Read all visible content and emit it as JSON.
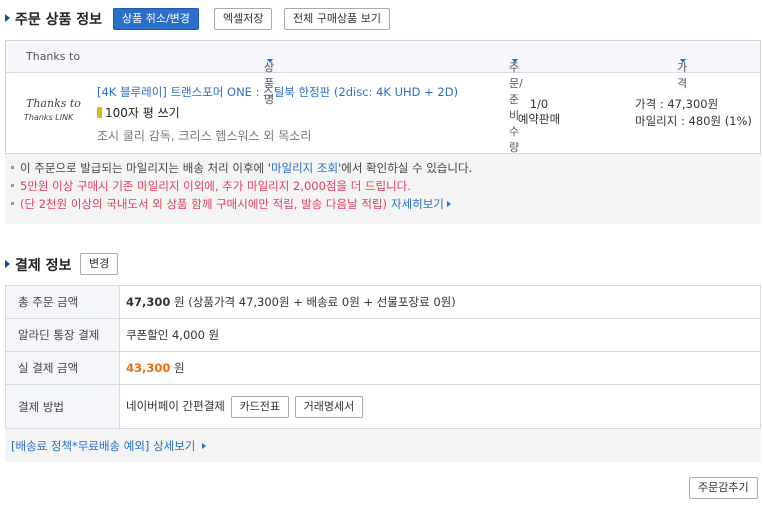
{
  "order_section": {
    "title": "주문 상품 정보",
    "buttons": {
      "cancel_change": "상품 취소/변경",
      "excel": "엑셀저장",
      "view_all": "전체 구매상품 보기"
    },
    "headers": {
      "thanks_to": "Thanks to",
      "product_name": "상품명",
      "order_qty": "주문/준비수량",
      "price": "가격"
    },
    "item": {
      "logo_line1": "Thanks to",
      "logo_line2": "Thanks LINK",
      "title": "[4K 블루레이] 트랜스포머 ONE : 스틸북 한정판 (2disc: 4K UHD + 2D)",
      "review": "100자 평 쓰기",
      "credits": "조시 쿨리 감독, 크리스 헴스워스 외 목소리",
      "qty": "1/0",
      "sale_type": "예약판매",
      "price": "가격 : 47,300원",
      "mileage": "마일리지 : 480원 (1%)"
    },
    "notices": {
      "n1_a": "이 주문으로 발급되는 마일리지는 배송 처리 이후에 '",
      "n1_link": "마일리지 조회",
      "n1_b": "'에서 확인하실 수 있습니다.",
      "n2": "5만원 이상 구매시 기존 마일리지 이외에, 추가 마일리지 2,000점을 더 드립니다.",
      "n3": "(단 2천원 이상의 국내도서 외 상품 함께 구매시에만 적립, 발송 다음날 적립)",
      "more": "자세히보기"
    }
  },
  "payment_section": {
    "title": "결제 정보",
    "change_button": "변경",
    "rows": {
      "total_label": "총 주문 금액",
      "total_amount": "47,300",
      "total_unit": "원",
      "total_detail": "(상품가격 47,300원 + 배송료 0원 + 선물포장료 0원)",
      "account_label": "알라딘 통장 결제",
      "account_value": "쿠폰할인 4,000 원",
      "actual_label": "실 결제 금액",
      "actual_amount": "43,300",
      "actual_unit": "원",
      "method_label": "결제 방법",
      "method_value": "네이버페이 간편결제",
      "card_slip": "카드전표",
      "statement": "거래명세서"
    },
    "policy_link": "[배송료 정책*무료배송 예외] 상세보기"
  },
  "footer": {
    "hide_button": "주문감추기"
  },
  "colors": {
    "accent": "#2a6fc9",
    "pink": "#e0415e",
    "orange": "#f06a13"
  }
}
